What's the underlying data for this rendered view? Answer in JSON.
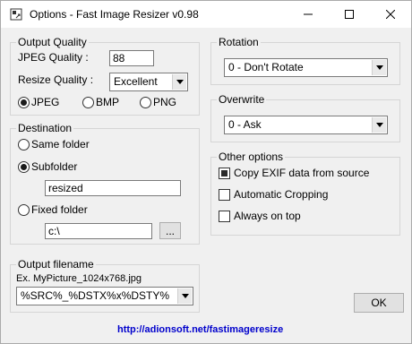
{
  "window": {
    "title": "Options - Fast Image Resizer v0.98",
    "minimize_glyph": "—",
    "close_glyph": "✕"
  },
  "output_quality": {
    "legend": "Output Quality",
    "jpeg_quality_label": "JPEG Quality :",
    "jpeg_quality_value": "88",
    "resize_quality_label": "Resize Quality :",
    "resize_quality_value": "Excellent",
    "formats": [
      {
        "label": "JPEG",
        "selected": true
      },
      {
        "label": "BMP",
        "selected": false
      },
      {
        "label": "PNG",
        "selected": false
      }
    ]
  },
  "destination": {
    "legend": "Destination",
    "same_folder_label": "Same folder",
    "subfolder_label": "Subfolder",
    "subfolder_value": "resized",
    "fixed_folder_label": "Fixed folder",
    "fixed_folder_value": "c:\\",
    "browse_label": "...",
    "selected": "subfolder"
  },
  "output_filename": {
    "legend": "Output filename",
    "example": "Ex. MyPicture_1024x768.jpg",
    "pattern_value": "%SRC%_%DSTX%x%DSTY%"
  },
  "rotation": {
    "legend": "Rotation",
    "value": "0 - Don't Rotate"
  },
  "overwrite": {
    "legend": "Overwrite",
    "value": "0 - Ask"
  },
  "other_options": {
    "legend": "Other options",
    "items": [
      {
        "label": "Copy EXIF data from source",
        "checked": true
      },
      {
        "label": "Automatic Cropping",
        "checked": false
      },
      {
        "label": "Always on top",
        "checked": false
      }
    ]
  },
  "ok_label": "OK",
  "website_link": "http://adionsoft.net/fastimageresize",
  "colors": {
    "link": "#0000cc",
    "dialog_bg": "#f0f0f0",
    "titlebar_bg": "#ffffff"
  }
}
